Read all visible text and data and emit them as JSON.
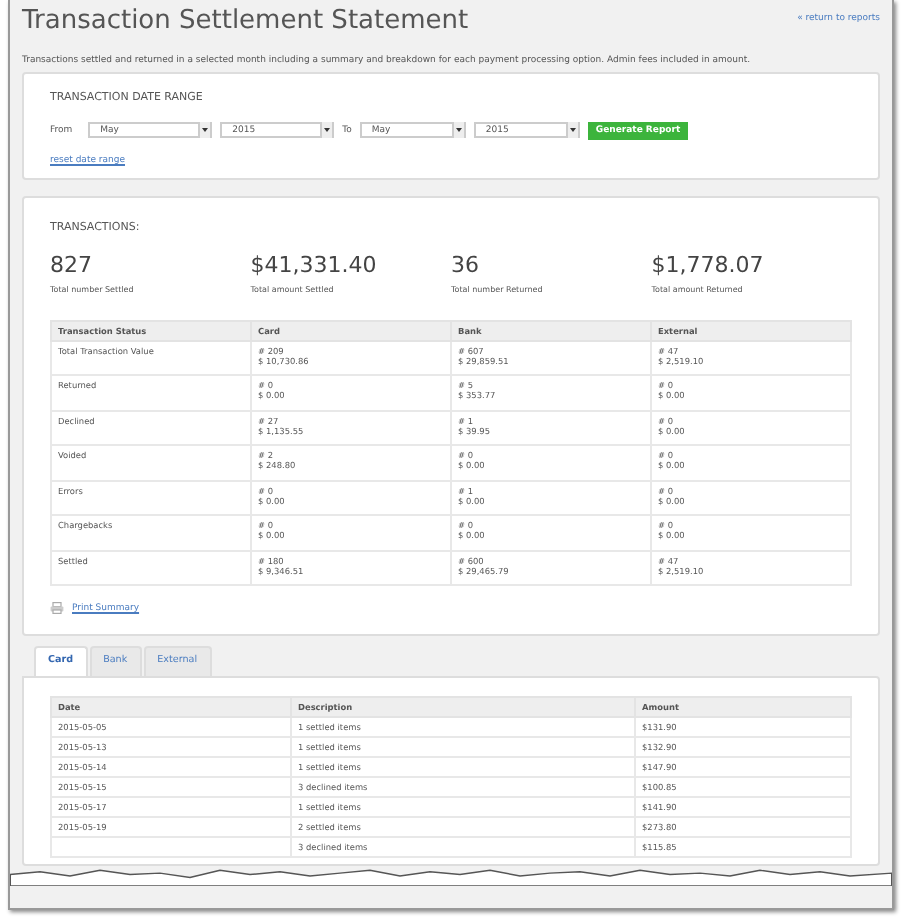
{
  "title": "Transaction Settlement Statement",
  "return_link": "« return to reports",
  "description": "Transactions settled and returned in a selected month including a summary and breakdown for each payment processing option. Admin fees included in amount.",
  "date_range": {
    "heading": "TRANSACTION DATE RANGE",
    "from_label": "From",
    "from_month": "May",
    "from_year": "2015",
    "to_label": "To",
    "to_month": "May",
    "to_year": "2015",
    "generate_button": "Generate Report",
    "reset_link": "reset date range"
  },
  "transactions": {
    "heading": "TRANSACTIONS:",
    "stats": [
      {
        "value": "827",
        "label": "Total number Settled"
      },
      {
        "value": "$41,331.40",
        "label": "Total amount Settled"
      },
      {
        "value": "36",
        "label": "Total number Returned"
      },
      {
        "value": "$1,778.07",
        "label": "Total amount Returned"
      }
    ],
    "columns": [
      "Transaction Status",
      "Card",
      "Bank",
      "External"
    ],
    "rows": [
      {
        "cells": [
          "Total Transaction Value",
          "# 209\n$ 10,730.86",
          "# 607\n$ 29,859.51",
          "# 47\n$ 2,519.10"
        ]
      },
      {
        "cells": [
          "Returned",
          "# 0\n$ 0.00",
          "# 5\n$ 353.77",
          "# 0\n$ 0.00"
        ]
      },
      {
        "cells": [
          "Declined",
          "# 27\n$ 1,135.55",
          "# 1\n$ 39.95",
          "# 0\n$ 0.00"
        ]
      },
      {
        "cells": [
          "Voided",
          "# 2\n$ 248.80",
          "# 0\n$ 0.00",
          "# 0\n$ 0.00"
        ]
      },
      {
        "cells": [
          "Errors",
          "# 0\n$ 0.00",
          "# 1\n$ 0.00",
          "# 0\n$ 0.00"
        ]
      },
      {
        "cells": [
          "Chargebacks",
          "# 0\n$ 0.00",
          "# 0\n$ 0.00",
          "# 0\n$ 0.00"
        ]
      },
      {
        "cells": [
          "Settled",
          "# 180\n$ 9,346.51",
          "# 600\n$ 29,465.79",
          "# 47\n$ 2,519.10"
        ]
      }
    ],
    "print_link": "Print Summary"
  },
  "tabs": [
    {
      "label": "Card",
      "selected": true
    },
    {
      "label": "Bank",
      "selected": false
    },
    {
      "label": "External",
      "selected": false
    }
  ],
  "detail_table": {
    "columns": [
      "Date",
      "Description",
      "Amount"
    ],
    "rows": [
      {
        "date": "2015-05-05",
        "description": "1 settled items",
        "amount": "$131.90"
      },
      {
        "date": "2015-05-13",
        "description": "1 settled items",
        "amount": "$132.90"
      },
      {
        "date": "2015-05-14",
        "description": "1 settled items",
        "amount": "$147.90"
      },
      {
        "date": "2015-05-15",
        "description": "3 declined items",
        "amount": "$100.85"
      },
      {
        "date": "2015-05-17",
        "description": "1 settled items",
        "amount": "$141.90"
      },
      {
        "date": "2015-05-19",
        "description": "2 settled items",
        "amount": "$273.80"
      },
      {
        "description": "3 declined items",
        "amount": "$115.85"
      }
    ]
  }
}
